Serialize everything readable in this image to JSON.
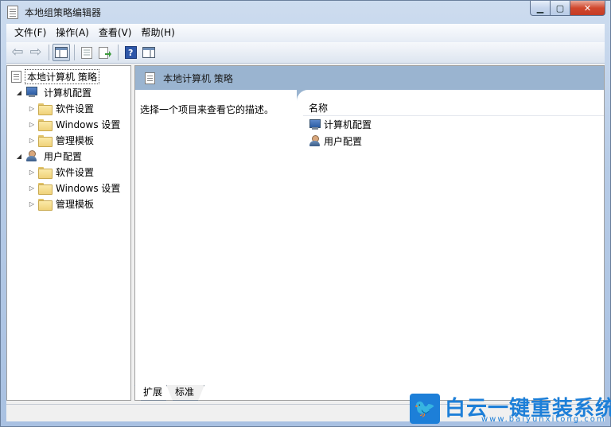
{
  "window": {
    "title": "本地组策略编辑器"
  },
  "menu": [
    "文件(F)",
    "操作(A)",
    "查看(V)",
    "帮助(H)"
  ],
  "tree": {
    "root": "本地计算机 策略",
    "computer": {
      "label": "计算机配置",
      "children": [
        "软件设置",
        "Windows 设置",
        "管理模板"
      ]
    },
    "user": {
      "label": "用户配置",
      "children": [
        "软件设置",
        "Windows 设置",
        "管理模板"
      ]
    }
  },
  "right": {
    "header": "本地计算机 策略",
    "description": "选择一个项目来查看它的描述。",
    "column": "名称",
    "items": [
      "计算机配置",
      "用户配置"
    ]
  },
  "tabs": [
    "扩展",
    "标准"
  ],
  "watermark": {
    "brand": "白云一键重装系统",
    "url": "www.baiyunxitong.com"
  },
  "colors": {
    "header_band": "#9ab4d0",
    "watermark": "#1d7fd8"
  }
}
